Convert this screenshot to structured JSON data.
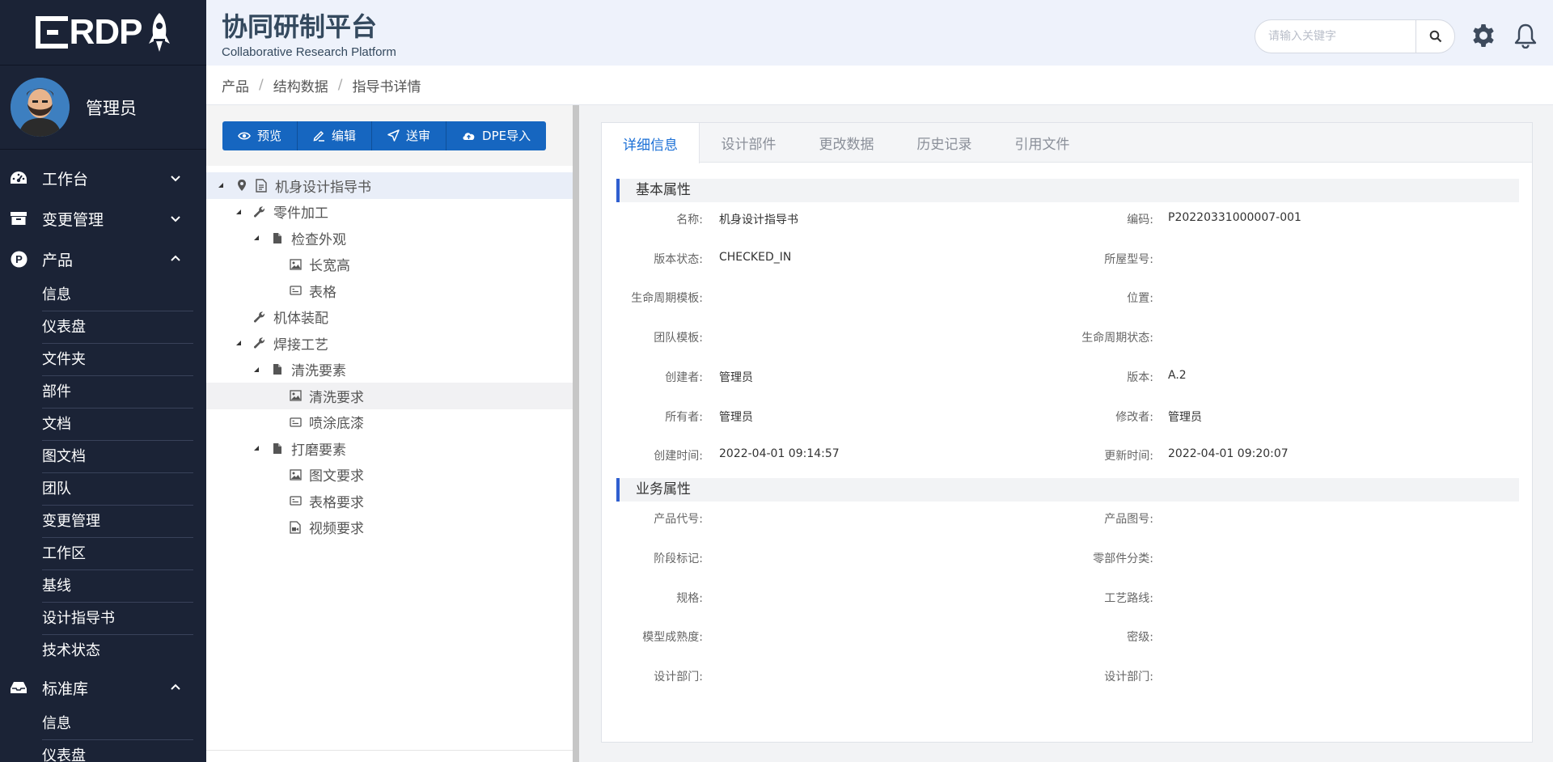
{
  "app": {
    "title": "协同研制平台",
    "subtitle": "Collaborative Research Platform",
    "logo_text": "RDP"
  },
  "search": {
    "placeholder": "请输入关键字"
  },
  "user": {
    "name": "管理员"
  },
  "sidebar": {
    "groups": [
      {
        "label": "工作台",
        "icon": "dashboard-icon",
        "expanded": false,
        "items": []
      },
      {
        "label": "变更管理",
        "icon": "archive-icon",
        "expanded": false,
        "items": []
      },
      {
        "label": "产品",
        "icon": "product-p-icon",
        "expanded": true,
        "items": [
          "信息",
          "仪表盘",
          "文件夹",
          "部件",
          "文档",
          "图文档",
          "团队",
          "变更管理",
          "工作区",
          "基线",
          "设计指导书",
          "技术状态"
        ]
      },
      {
        "label": "标准库",
        "icon": "inbox-icon",
        "expanded": true,
        "items": [
          "信息",
          "仪表盘"
        ]
      }
    ]
  },
  "breadcrumb": [
    "产品",
    "结构数据",
    "指导书详情"
  ],
  "toolbar": {
    "preview": "预览",
    "edit": "编辑",
    "send_review": "送审",
    "dpe_import": "DPE导入"
  },
  "tree": [
    {
      "label": "机身设计指导书",
      "depth": 0,
      "icon": "document-icon",
      "arrow": true,
      "pin": true,
      "state": "selected"
    },
    {
      "label": "零件加工",
      "depth": 1,
      "icon": "wrench-icon",
      "arrow": true
    },
    {
      "label": "检查外观",
      "depth": 2,
      "icon": "file-icon",
      "arrow": true
    },
    {
      "label": "长宽高",
      "depth": 3,
      "icon": "image-icon",
      "arrow": false
    },
    {
      "label": "表格",
      "depth": 3,
      "icon": "table-icon",
      "arrow": false
    },
    {
      "label": "机体装配",
      "depth": 1,
      "icon": "wrench-icon",
      "arrow": false
    },
    {
      "label": "焊接工艺",
      "depth": 1,
      "icon": "wrench-icon",
      "arrow": true
    },
    {
      "label": "清洗要素",
      "depth": 2,
      "icon": "file-icon",
      "arrow": true
    },
    {
      "label": "清洗要求",
      "depth": 3,
      "icon": "image-icon",
      "arrow": false,
      "state": "hover"
    },
    {
      "label": "喷涂底漆",
      "depth": 3,
      "icon": "table-icon",
      "arrow": false
    },
    {
      "label": "打磨要素",
      "depth": 2,
      "icon": "file-icon",
      "arrow": true
    },
    {
      "label": "图文要求",
      "depth": 3,
      "icon": "image-icon",
      "arrow": false
    },
    {
      "label": "表格要求",
      "depth": 3,
      "icon": "table-icon",
      "arrow": false
    },
    {
      "label": "视频要求",
      "depth": 3,
      "icon": "video-icon",
      "arrow": false
    }
  ],
  "tabs": [
    "详细信息",
    "设计部件",
    "更改数据",
    "历史记录",
    "引用文件"
  ],
  "active_tab": "详细信息",
  "sections": {
    "basic": {
      "title": "基本属性",
      "rows": [
        [
          {
            "label": "名称:",
            "value": "机身设计指导书"
          },
          {
            "label": "编码:",
            "value": "P20220331000007-001"
          }
        ],
        [
          {
            "label": "版本状态:",
            "value": "CHECKED_IN"
          },
          {
            "label": "所屋型号:",
            "value": ""
          }
        ],
        [
          {
            "label": "生命周期模板:",
            "value": ""
          },
          {
            "label": "位置:",
            "value": ""
          }
        ],
        [
          {
            "label": "团队模板:",
            "value": ""
          },
          {
            "label": "生命周期状态:",
            "value": ""
          }
        ],
        [
          {
            "label": "创建者:",
            "value": "管理员"
          },
          {
            "label": "版本:",
            "value": "A.2"
          }
        ],
        [
          {
            "label": "所有者:",
            "value": "管理员"
          },
          {
            "label": "修改者:",
            "value": "管理员"
          }
        ],
        [
          {
            "label": "创建时间:",
            "value": "2022-04-01 09:14:57"
          },
          {
            "label": "更新时间:",
            "value": "2022-04-01 09:20:07"
          }
        ]
      ]
    },
    "business": {
      "title": "业务属性",
      "rows": [
        [
          {
            "label": "产品代号:",
            "value": ""
          },
          {
            "label": "产品图号:",
            "value": ""
          }
        ],
        [
          {
            "label": "阶段标记:",
            "value": ""
          },
          {
            "label": "零部件分类:",
            "value": ""
          }
        ],
        [
          {
            "label": "规格:",
            "value": ""
          },
          {
            "label": "工艺路线:",
            "value": ""
          }
        ],
        [
          {
            "label": "模型成熟度:",
            "value": ""
          },
          {
            "label": "密级:",
            "value": ""
          }
        ],
        [
          {
            "label": "设计部门:",
            "value": ""
          },
          {
            "label": "设计部门:",
            "value": ""
          }
        ]
      ]
    }
  },
  "colors": {
    "sidebar_bg": "#1b2336",
    "header_bg": "#eef2fb",
    "primary_button": "#1666c0",
    "active_tab_text": "#1a6fd6",
    "section_accent": "#2f5fd0"
  }
}
